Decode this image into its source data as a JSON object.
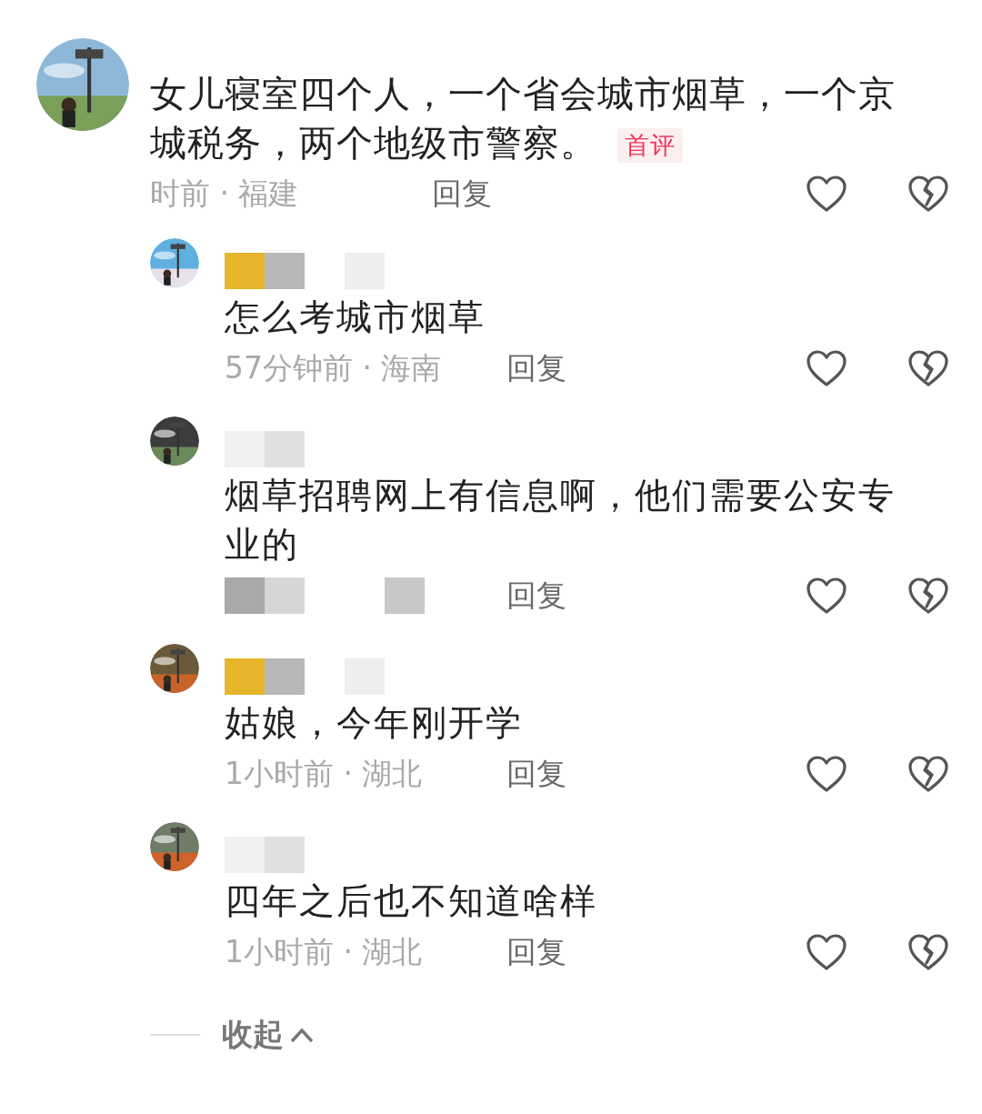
{
  "comment": {
    "text": "女儿寝室四个人，一个省会城市烟草，一个京城税务，两个地级市警察。",
    "badge": "首评",
    "meta": "时前 · 福建",
    "reply_label": "回复"
  },
  "replies": [
    {
      "text": "怎么考城市烟草",
      "meta": "57分钟前 · 海南",
      "reply_label": "回复"
    },
    {
      "text": "烟草招聘网上有信息啊，他们需要公安专业的",
      "reply_label": "回复"
    },
    {
      "text": "姑娘，今年刚开学",
      "meta": "1小时前 · 湖北",
      "reply_label": "回复"
    },
    {
      "text": "四年之后也不知道啥样",
      "meta": "1小时前 · 湖北",
      "reply_label": "回复"
    }
  ],
  "collapse": {
    "label": "收起"
  }
}
